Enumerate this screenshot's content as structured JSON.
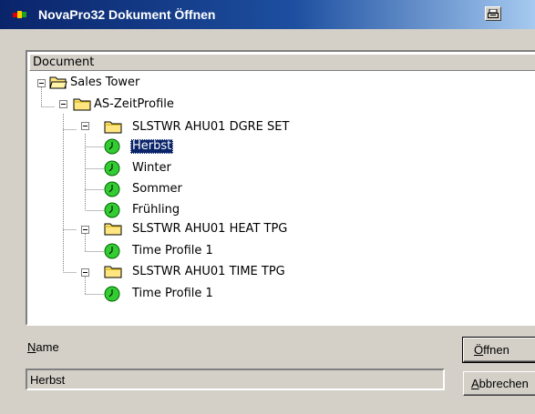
{
  "window": {
    "title": "NovaPro32 Dokument Öffnen"
  },
  "tree": {
    "column_header": "Document",
    "root": {
      "label": "Sales Tower",
      "icon": "folder-open-icon"
    },
    "folder": {
      "label": "AS-ZeitProfile",
      "icon": "folder-icon"
    },
    "groups": [
      {
        "label": "SLSTWR AHU01 DGRE SET",
        "items": [
          "Herbst",
          "Winter",
          "Sommer",
          "Frühling"
        ]
      },
      {
        "label": "SLSTWR AHU01 HEAT TPG",
        "items": [
          "Time Profile 1"
        ]
      },
      {
        "label": "SLSTWR AHU01 TIME TPG",
        "items": [
          "Time Profile 1"
        ]
      }
    ],
    "selected_item": "Herbst"
  },
  "form": {
    "name_label_accel": "N",
    "name_label_rest": "ame",
    "name_value": "Herbst"
  },
  "buttons": {
    "open_accel": "Ö",
    "open_rest": "ffnen",
    "cancel_accel": "A",
    "cancel_rest": "bbrechen"
  },
  "colors": {
    "title_bar": "#0a246a",
    "selection": "#0a246a",
    "clock_icon": "#33cc33",
    "folder_icon": "#ffe680"
  }
}
